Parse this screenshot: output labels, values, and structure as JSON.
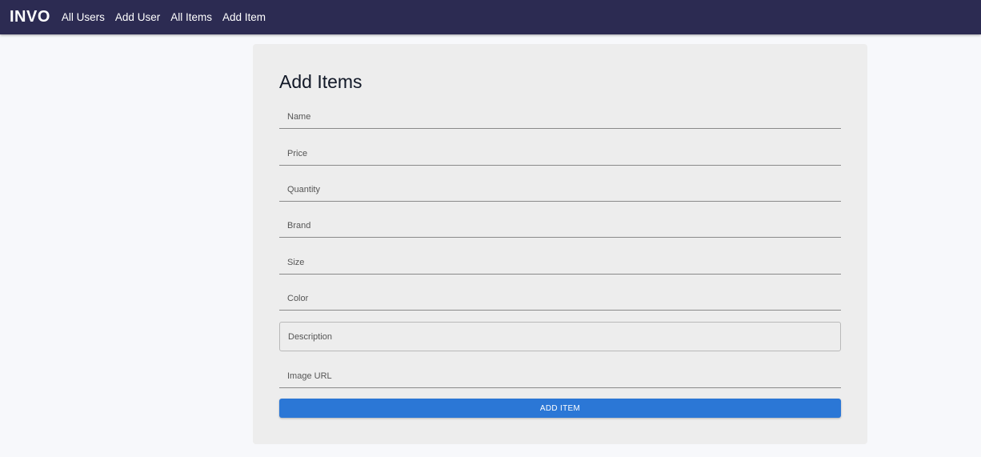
{
  "navbar": {
    "brand": "INVO",
    "links": [
      "All Users",
      "Add User",
      "All Items",
      "Add Item"
    ],
    "background": "#2c2b52"
  },
  "form": {
    "title": "Add Items",
    "fields": {
      "name": "Name",
      "price": "Price",
      "quantity": "Quantity",
      "brand": "Brand",
      "size": "Size",
      "color": "Color",
      "description": "Description",
      "image_url": "Image URL"
    },
    "submit_label": "ADD ITEM",
    "accent": "#2b77d6"
  }
}
